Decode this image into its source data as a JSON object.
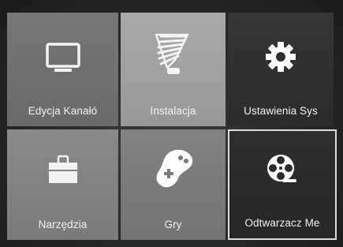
{
  "menu": {
    "tiles": [
      {
        "label": "Edycja Kanałó",
        "icon": "monitor-icon"
      },
      {
        "label": "Instalacja",
        "icon": "satellite-dish-icon"
      },
      {
        "label": "Ustawienia Sys",
        "icon": "gear-icon"
      },
      {
        "label": "Narzędzia",
        "icon": "toolbox-icon"
      },
      {
        "label": "Gry",
        "icon": "gamepad-icon"
      },
      {
        "label": "Odtwarzacz Me",
        "icon": "film-reel-icon",
        "selected": true
      }
    ]
  }
}
